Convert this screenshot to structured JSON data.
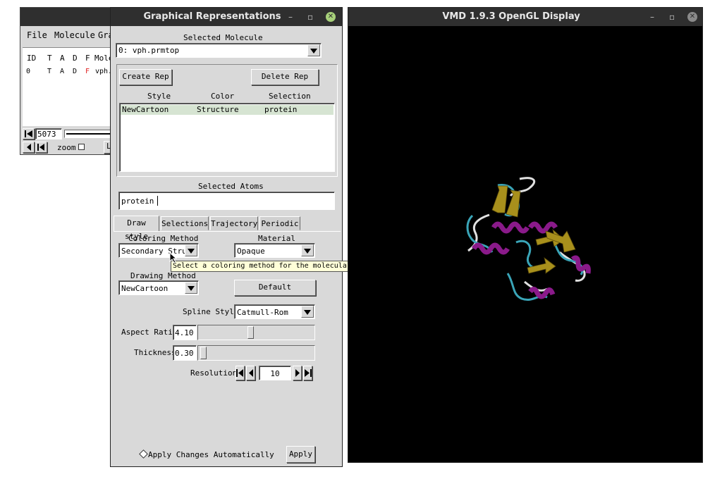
{
  "main_window": {
    "menu": [
      "File",
      "Molecule",
      "Gra"
    ],
    "columns": [
      "ID",
      "T",
      "A",
      "D",
      "F",
      "Mole"
    ],
    "row": {
      "id": "0",
      "t": "T",
      "a": "A",
      "d": "D",
      "f": "F",
      "mol": "vph."
    },
    "frame": "5073",
    "zoom_label": "zoom",
    "partial_btn": "L"
  },
  "graphrep": {
    "title": "Graphical Representations",
    "selected_molecule_label": "Selected Molecule",
    "selected_molecule": "0: vph.prmtop",
    "create_rep": "Create Rep",
    "delete_rep": "Delete Rep",
    "rep_headers": {
      "style": "Style",
      "color": "Color",
      "selection": "Selection"
    },
    "reps": [
      {
        "style": "NewCartoon",
        "color": "Structure",
        "selection": "protein"
      }
    ],
    "selected_atoms_label": "Selected Atoms",
    "selected_atoms": "protein",
    "tabs": [
      "Draw style",
      "Selections",
      "Trajectory",
      "Periodic"
    ],
    "coloring_method_label": "Coloring Method",
    "coloring_method": "Secondary Struct",
    "material_label": "Material",
    "material": "Opaque",
    "tooltip": "Select a coloring method for the molecular representation",
    "drawing_method_label": "Drawing Method",
    "drawing_method": "NewCartoon",
    "default_btn": "Default",
    "spline_style_label": "Spline Style",
    "spline_style": "Catmull-Rom",
    "aspect_ratio_label": "Aspect Ratio",
    "aspect_ratio": "4.10",
    "aspect_ratio_level": 0.45,
    "thickness_label": "Thickness",
    "thickness": "0.30",
    "thickness_level": 0.02,
    "resolution_label": "Resolution",
    "resolution": "10",
    "apply_auto": "Apply Changes Automatically",
    "apply": "Apply"
  },
  "display": {
    "title": "VMD 1.9.3 OpenGL Display"
  },
  "colors": {
    "titlebar": "#2f2f2f",
    "close": "#a7d07a",
    "selected_row": "#d6e4d2",
    "helix": "#8a1a8a",
    "sheet": "#a8901c",
    "turn": "#3aa5b8",
    "coil": "#e0e0e0"
  }
}
